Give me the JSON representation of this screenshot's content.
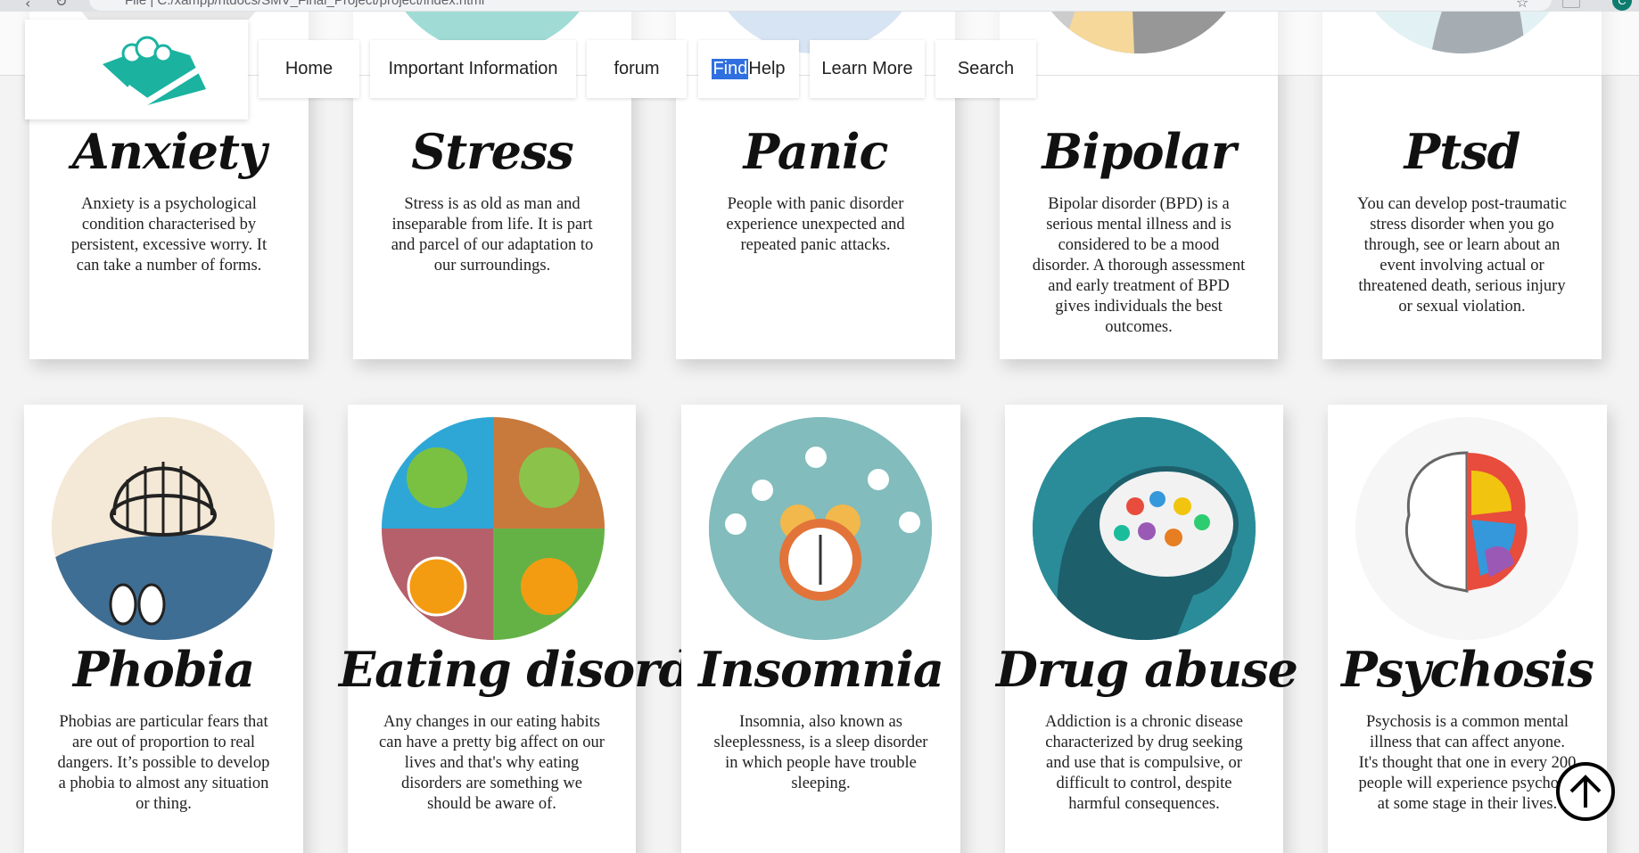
{
  "browser": {
    "url": "File | C:/xampp/htdocs/SMV_Final_Project/project/index.html",
    "profile_initial": "C"
  },
  "nav": {
    "home": "Home",
    "important": "Important Information",
    "forum": "forum",
    "find_highlight": "Find",
    "find_rest": "Help",
    "learn": "Learn More",
    "search": "Search"
  },
  "colors": {
    "logo_teal": "#19b5a3",
    "find_highlight": "#2f6fe0"
  },
  "cards": [
    {
      "title": "Anxiety",
      "desc": "Anxiety is a psychological condition characterised by persistent, excessive worry. It can take a number of forms."
    },
    {
      "title": "Stress",
      "desc": "Stress is as old as man and inseparable from life. It is part and parcel of our adaptation to our surroundings."
    },
    {
      "title": "Panic",
      "desc": "People with panic disorder experience unexpected and repeated panic attacks."
    },
    {
      "title": "Bipolar",
      "desc": "Bipolar disorder (BPD) is a serious mental illness and is considered to be a mood disorder. A thorough assessment and early treatment of BPD gives individuals the best outcomes."
    },
    {
      "title": "Ptsd",
      "desc": "You can develop post-traumatic stress disorder when you go through, see or learn about an event involving actual or threatened death, serious injury or sexual violation."
    },
    {
      "title": "Phobia",
      "desc": "Phobias are particular fears that are out of proportion to real dangers. It’s possible to develop a phobia to almost any situation or thing."
    },
    {
      "title": "Eating disorder",
      "desc": "Any changes in our eating habits can have a pretty big affect on our lives and that's why eating disorders are something we should be aware of."
    },
    {
      "title": "Insomnia",
      "desc": "Insomnia, also known as sleeplessness, is a sleep disorder in which people have trouble sleeping."
    },
    {
      "title": "Drug abuse",
      "desc": "Addiction is a chronic disease characterized by drug seeking and use that is compulsive, or difficult to control, despite harmful consequences."
    },
    {
      "title": "Psychosis",
      "desc": "Psychosis is a common mental illness that can affect anyone. It's thought that one in every 200 people will experience psychosis at some stage in their lives."
    }
  ]
}
